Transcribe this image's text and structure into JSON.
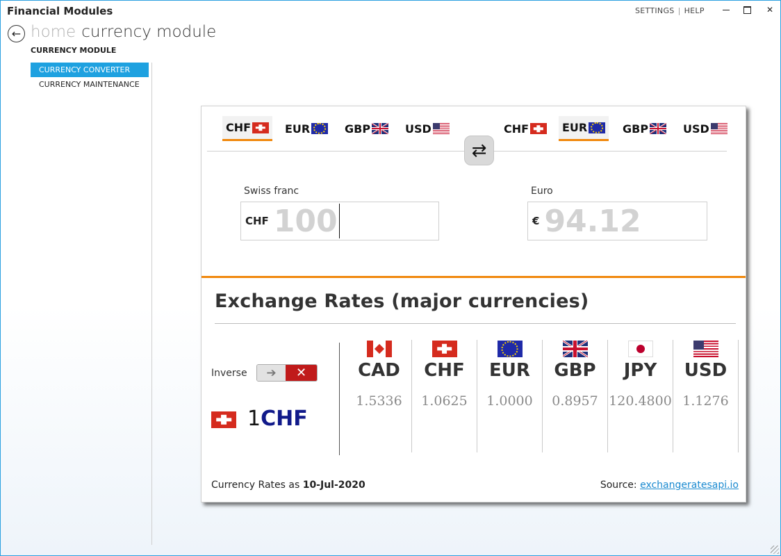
{
  "window": {
    "title": "Financial Modules",
    "settings_label": "SETTINGS",
    "help_label": "HELP",
    "separator": "|"
  },
  "breadcrumb": {
    "home": "home",
    "current": "currency module"
  },
  "sidebar": {
    "heading": "CURRENCY MODULE",
    "items": [
      {
        "label": "CURRENCY CONVERTER",
        "active": true
      },
      {
        "label": "CURRENCY MAINTENANCE",
        "active": false
      }
    ]
  },
  "converter": {
    "from_tabs": [
      "CHF",
      "EUR",
      "GBP",
      "USD"
    ],
    "to_tabs": [
      "CHF",
      "EUR",
      "GBP",
      "USD"
    ],
    "from_selected": "CHF",
    "to_selected": "EUR",
    "from_label": "Swiss franc",
    "from_prefix": "CHF",
    "from_value": "100",
    "to_label": "Euro",
    "to_prefix": "€",
    "to_value": "94.12"
  },
  "rates": {
    "title": "Exchange Rates (major currencies)",
    "inverse_label": "Inverse",
    "inverse_enabled": false,
    "base_amount": "1",
    "base_code": "CHF",
    "columns": [
      {
        "code": "CAD",
        "rate": "1.5336",
        "flag": "cad"
      },
      {
        "code": "CHF",
        "rate": "1.0625",
        "flag": "chf"
      },
      {
        "code": "EUR",
        "rate": "1.0000",
        "flag": "eur"
      },
      {
        "code": "GBP",
        "rate": "0.8957",
        "flag": "gbp"
      },
      {
        "code": "JPY",
        "rate": "120.4800",
        "flag": "jpy"
      },
      {
        "code": "USD",
        "rate": "1.1276",
        "flag": "usd"
      }
    ],
    "as_of_prefix": "Currency Rates as",
    "as_of_date": "10-Jul-2020",
    "source_prefix": "Source:",
    "source_link": "exchangeratesapi.io"
  },
  "colors": {
    "accent_blue": "#1ea1e0",
    "accent_orange": "#f0870b",
    "toggle_red": "#c01a1a",
    "base_code_blue": "#111a8a"
  },
  "icons": {
    "back": "back-arrow-icon",
    "swap": "swap-arrows-icon",
    "toggle_arrow": "arrow-right-icon",
    "toggle_x": "close-icon"
  }
}
